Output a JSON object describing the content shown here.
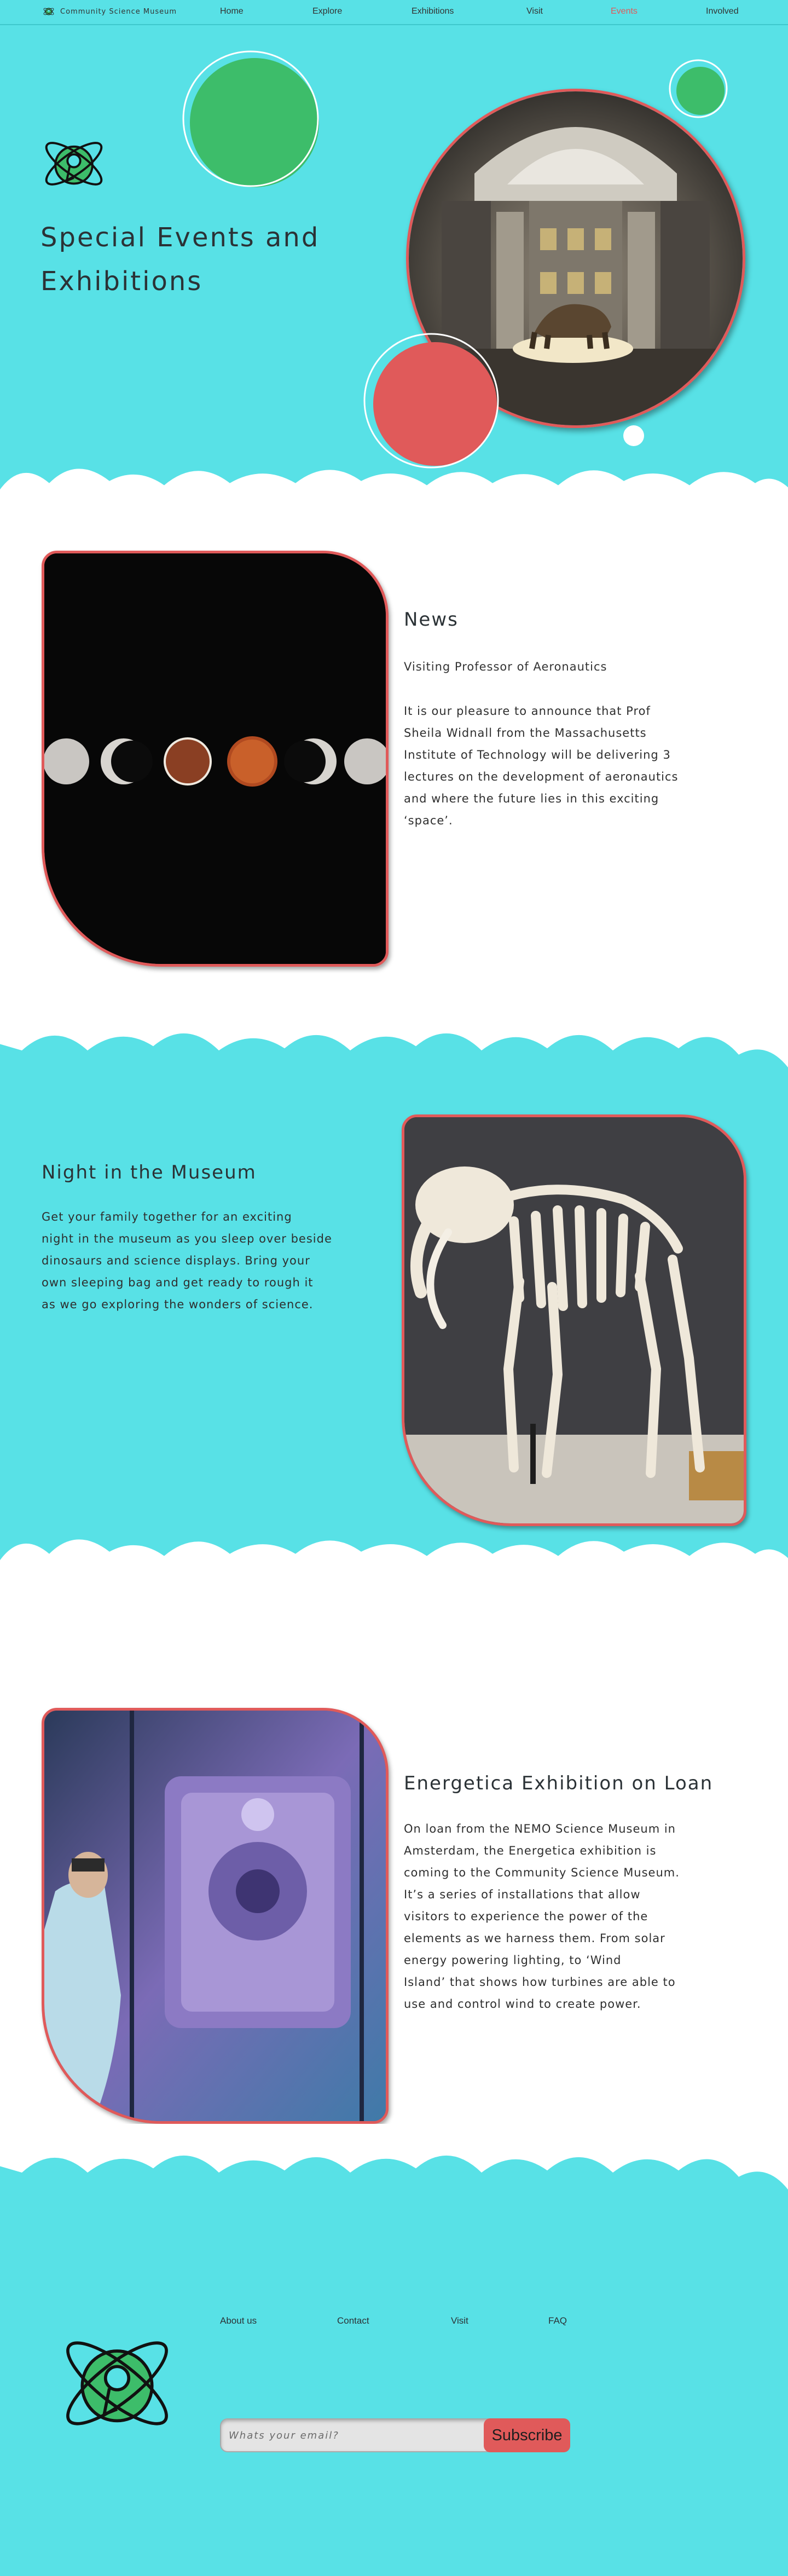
{
  "nav": {
    "brand": "Community Science Museum",
    "links": [
      {
        "label": "Home"
      },
      {
        "label": "Explore"
      },
      {
        "label": "Exhibitions"
      },
      {
        "label": "Visit"
      },
      {
        "label": "Events"
      },
      {
        "label": "Involved"
      }
    ],
    "active": "Events"
  },
  "hero": {
    "title_line1": "Special Events and",
    "title_line2": "Exhibitions"
  },
  "news": {
    "heading": "News",
    "subheading": "Visiting Professor of Aeronautics",
    "body_lines": [
      "It is our pleasure to announce that Prof",
      "Sheila Widnall from the Massachusetts",
      "Institute of Technology will be delivering 3",
      "lectures on the development of aeronautics",
      "and where the future lies in this exciting",
      "‘space’."
    ]
  },
  "night": {
    "heading": "Night in the Museum",
    "body_lines": [
      "Get your family together for an exciting",
      "night in the museum as you sleep over beside",
      "dinosaurs and science displays. Bring your",
      "own sleeping bag and get ready to rough it",
      "as we go exploring the wonders of science."
    ]
  },
  "energetica": {
    "heading": "Energetica Exhibition on Loan",
    "body_lines": [
      "On loan from the NEMO Science Museum in",
      "Amsterdam, the Energetica exhibition is",
      "coming to the Community Science Museum.",
      "It’s a series of installations that allow",
      "visitors to experience the power of the",
      "elements as we harness them. From solar",
      "energy powering lighting, to ‘Wind",
      "Island’ that shows how turbines are able to",
      "use and control wind to create power."
    ]
  },
  "footer": {
    "links": [
      {
        "label": "About us"
      },
      {
        "label": "Contact"
      },
      {
        "label": "Visit"
      },
      {
        "label": "FAQ"
      }
    ],
    "email_placeholder": "Whats your email?",
    "subscribe_label": "Subscribe"
  },
  "colors": {
    "cyan": "#58e1e6",
    "coral": "#e05a5a",
    "green": "#3dbd6a",
    "active_link": "#e05a5a"
  },
  "icons": [
    "atom-logo-icon"
  ]
}
